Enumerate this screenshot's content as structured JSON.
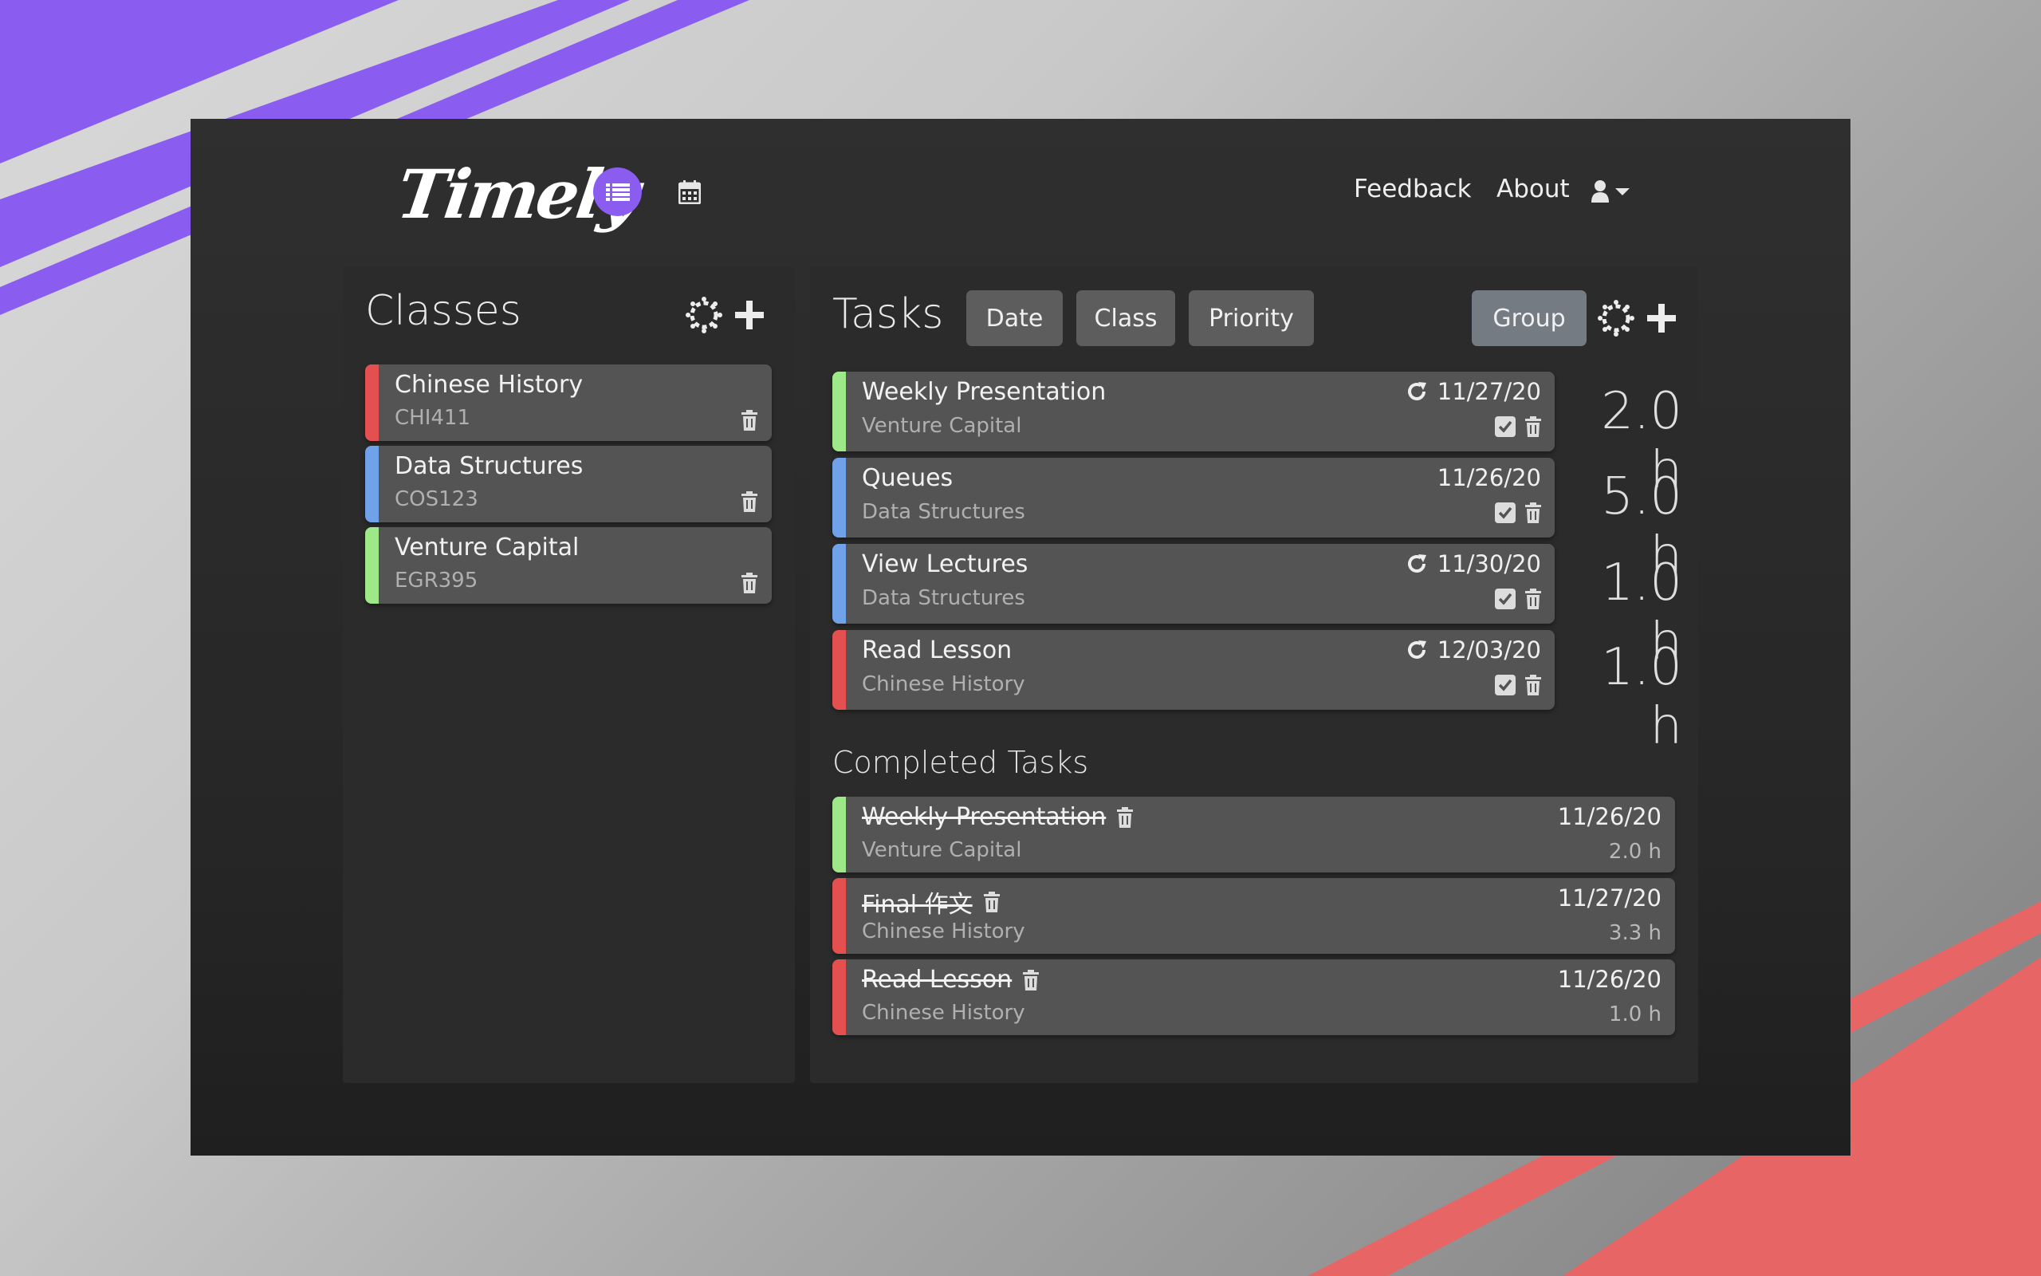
{
  "colors": {
    "accent": "#8a5cf0",
    "history_red": "#e45050",
    "structures_blue": "#6fa2e8",
    "capital_green": "#9ee88a"
  },
  "nav": {
    "logo": "Timely",
    "list_icon": "list-icon",
    "calendar_icon": "calendar-icon",
    "feedback": "Feedback",
    "about": "About",
    "user_icon": "user-icon"
  },
  "classes": {
    "title": "Classes",
    "items": [
      {
        "name": "Chinese History",
        "code": "CHI411",
        "color": "#e45050"
      },
      {
        "name": "Data Structures",
        "code": "COS123",
        "color": "#6fa2e8"
      },
      {
        "name": "Venture Capital",
        "code": "EGR395",
        "color": "#9ee88a"
      }
    ]
  },
  "tasks": {
    "title": "Tasks",
    "sort_buttons": {
      "date": "Date",
      "class": "Class",
      "priority": "Priority"
    },
    "group": "Group",
    "items": [
      {
        "name": "Weekly Presentation",
        "class": "Venture Capital",
        "date": "11/27/20",
        "hours": "2.0 h",
        "recurring": true,
        "color": "#9ee88a"
      },
      {
        "name": "Queues",
        "class": "Data Structures",
        "date": "11/26/20",
        "hours": "5.0 h",
        "recurring": false,
        "color": "#6fa2e8"
      },
      {
        "name": "View Lectures",
        "class": "Data Structures",
        "date": "11/30/20",
        "hours": "1.0 h",
        "recurring": true,
        "color": "#6fa2e8"
      },
      {
        "name": "Read Lesson",
        "class": "Chinese History",
        "date": "12/03/20",
        "hours": "1.0 h",
        "recurring": true,
        "color": "#e45050"
      }
    ]
  },
  "completed": {
    "title": "Completed Tasks",
    "items": [
      {
        "name": "Weekly Presentation",
        "class": "Venture Capital",
        "date": "11/26/20",
        "hours": "2.0 h",
        "color": "#9ee88a"
      },
      {
        "name": "Final 作文",
        "class": "Chinese History",
        "date": "11/27/20",
        "hours": "3.3 h",
        "color": "#e45050"
      },
      {
        "name": "Read Lesson",
        "class": "Chinese History",
        "date": "11/26/20",
        "hours": "1.0 h",
        "color": "#e45050"
      }
    ]
  }
}
